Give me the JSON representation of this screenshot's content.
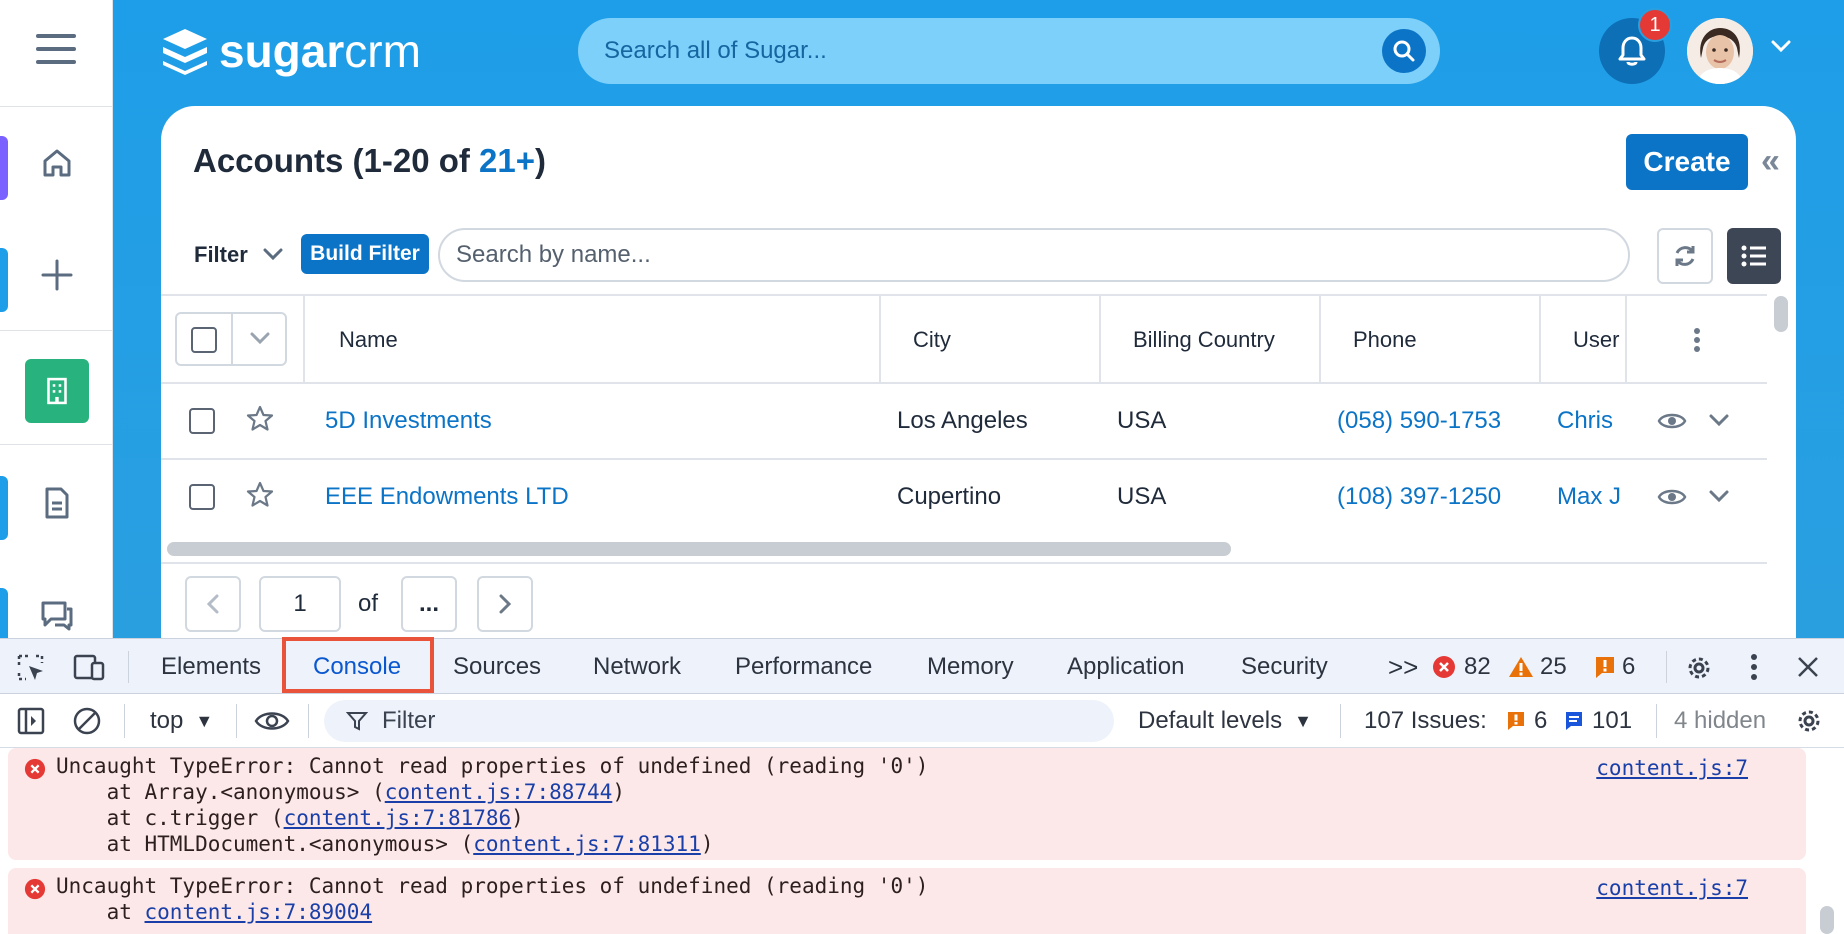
{
  "header": {
    "logo_bold": "sugar",
    "logo_light": "crm",
    "search_placeholder": "Search all of Sugar...",
    "notification_count": "1"
  },
  "panel": {
    "title_prefix": "Accounts (1-20 of ",
    "title_count": "21+",
    "title_suffix": ")",
    "create_label": "Create",
    "filter_label": "Filter",
    "build_filter_label": "Build Filter",
    "name_search_placeholder": "Search by name..."
  },
  "table": {
    "columns": [
      "Name",
      "City",
      "Billing Country",
      "Phone",
      "User"
    ],
    "rows": [
      {
        "name": "5D Investments",
        "city": "Los Angeles",
        "country": "USA",
        "phone": "(058) 590-1753",
        "user": "Chris"
      },
      {
        "name": "EEE Endowments LTD",
        "city": "Cupertino",
        "country": "USA",
        "phone": "(108) 397-1250",
        "user": "Max J"
      }
    ]
  },
  "pager": {
    "page": "1",
    "of": "of",
    "total": "..."
  },
  "devtools": {
    "tabs": [
      "Elements",
      "Console",
      "Sources",
      "Network",
      "Performance",
      "Memory",
      "Application",
      "Security"
    ],
    "more": ">>",
    "errors": "82",
    "warnings": "25",
    "issues_badge": "6",
    "context": "top",
    "filter_placeholder": "Filter",
    "levels": "Default levels",
    "issues_label": "107 Issues:",
    "issues_warn": "6",
    "issues_info": "101",
    "hidden": "4 hidden",
    "colors": {
      "error": "#e53935",
      "warning": "#e8710a",
      "link": "#1a3fa8"
    }
  },
  "console": {
    "entries": [
      {
        "message": "Uncaught TypeError: Cannot read properties of undefined (reading '0')",
        "source": "content.js:7",
        "trace": [
          {
            "prefix": "    at Array.<anonymous> (",
            "link": "content.js:7:88744",
            "suffix": ")"
          },
          {
            "prefix": "    at c.trigger (",
            "link": "content.js:7:81786",
            "suffix": ")"
          },
          {
            "prefix": "    at HTMLDocument.<anonymous> (",
            "link": "content.js:7:81311",
            "suffix": ")"
          }
        ]
      },
      {
        "message": "Uncaught TypeError: Cannot read properties of undefined (reading '0')",
        "source": "content.js:7",
        "trace": [
          {
            "prefix": "    at ",
            "link": "content.js:7:89004",
            "suffix": ""
          }
        ]
      }
    ]
  }
}
